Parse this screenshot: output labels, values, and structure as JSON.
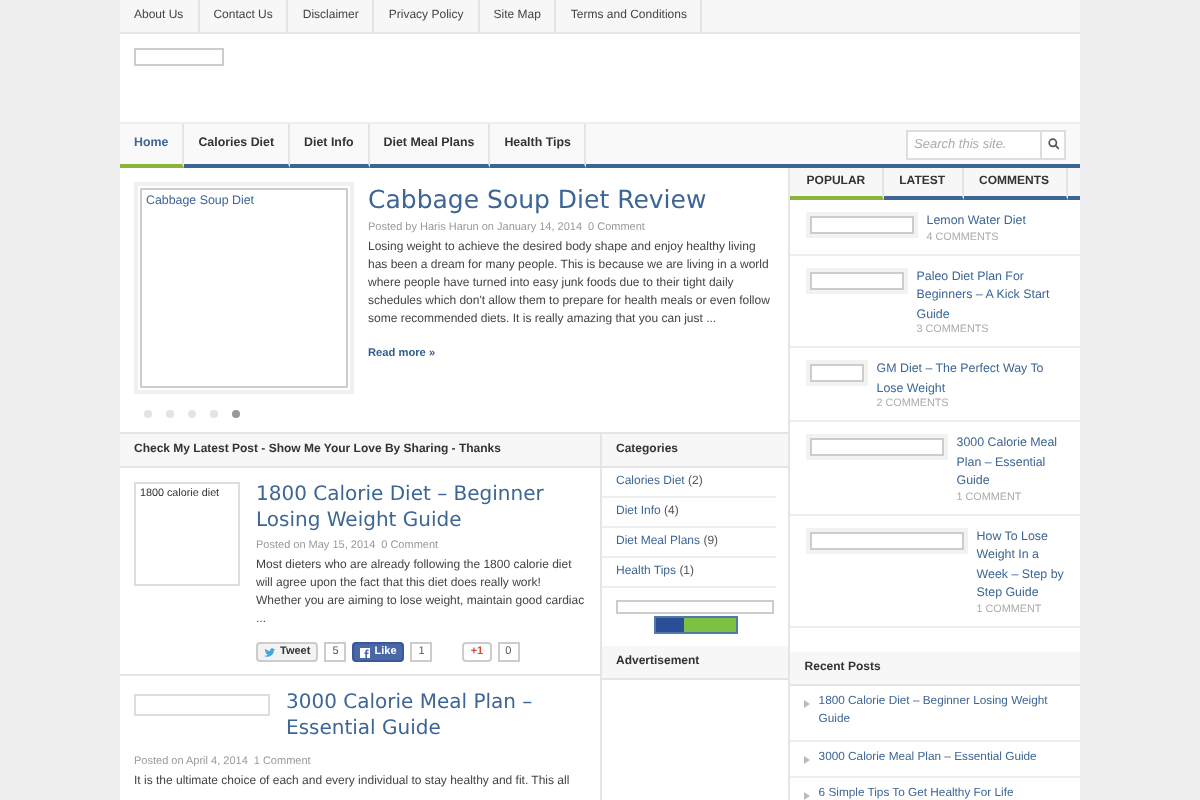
{
  "top_links": [
    "About Us",
    "Contact Us",
    "Disclaimer",
    "Privacy Policy",
    "Site Map",
    "Terms and Conditions"
  ],
  "nav": {
    "items": [
      {
        "label": "Home",
        "selected": true
      },
      {
        "label": "Calories Diet",
        "selected": false
      },
      {
        "label": "Diet Info",
        "selected": false
      },
      {
        "label": "Diet Meal Plans",
        "selected": false
      },
      {
        "label": "Health Tips",
        "selected": false
      }
    ],
    "search_placeholder": "Search this site."
  },
  "slider": {
    "image_alt": "Cabbage Soup Diet",
    "title": "Cabbage Soup Diet Review",
    "meta": "Posted by Haris Harun on January 14, 2014",
    "comments": "0 Comment",
    "excerpt": "Losing weight to achieve the desired body shape and enjoy healthy living has been a dream for many people. This is because we are living in a world where people have turned into easy junk foods due to their tight daily schedules which don't allow them to prepare for health meals or even follow some recommended diets. It is really amazing that you can just ...",
    "read_more": "Read more »",
    "dots": [
      {
        "selected": false
      },
      {
        "selected": false
      },
      {
        "selected": false
      },
      {
        "selected": false
      },
      {
        "selected": true
      }
    ]
  },
  "latest": {
    "heading": "Check My Latest Post - Show Me Your Love By Sharing - Thanks",
    "posts": [
      {
        "image_alt": "1800 calorie diet",
        "title": "1800 Calorie Diet – Beginner Losing Weight Guide",
        "meta": "Posted on May 15, 2014",
        "comments": "0 Comment",
        "excerpt": "Most dieters who are already following the 1800 calorie diet will agree upon the fact that this diet does really work! Whether you are aiming to lose weight, maintain good cardiac ...",
        "share": [
          {
            "kind": "tweet",
            "label": "Tweet",
            "count": "5"
          },
          {
            "kind": "like",
            "label": "Like",
            "count": "1"
          },
          {
            "kind": "gplus",
            "label": "+1",
            "count": "0"
          }
        ]
      },
      {
        "title": "3000 Calorie Meal Plan – Essential Guide",
        "meta": "Posted on April 4, 2014",
        "comments": "1 Comment",
        "excerpt": "It is the ultimate choice of each and every individual to stay healthy and fit. This all"
      }
    ]
  },
  "categories": {
    "heading": "Categories",
    "items": [
      {
        "label": "Calories Diet",
        "count": "(2)"
      },
      {
        "label": "Diet Info",
        "count": "(4)"
      },
      {
        "label": "Diet Meal Plans",
        "count": "(9)"
      },
      {
        "label": "Health Tips",
        "count": "(1)"
      }
    ]
  },
  "advertisement": {
    "heading": "Advertisement"
  },
  "sidebar": {
    "tabs": [
      {
        "label": "POPULAR",
        "selected": true
      },
      {
        "label": "LATEST",
        "selected": false
      },
      {
        "label": "COMMENTS",
        "selected": false
      }
    ],
    "popular": [
      {
        "title": "Lemon Water Diet",
        "comments": "4 COMMENTS"
      },
      {
        "title": "Paleo Diet Plan For Beginners – A Kick Start Guide",
        "comments": "3 COMMENTS"
      },
      {
        "title": "GM Diet – The Perfect Way To Lose Weight",
        "comments": "2 COMMENTS"
      },
      {
        "title": "3000 Calorie Meal Plan – Essential Guide",
        "comments": "1 COMMENT"
      },
      {
        "title": "How To Lose Weight In a Week – Step by Step Guide",
        "comments": "1 COMMENT"
      }
    ],
    "recent_heading": "Recent Posts",
    "recent": [
      "1800 Calorie Diet – Beginner Losing Weight Guide",
      "3000 Calorie Meal Plan – Essential Guide",
      "6 Simple Tips To Get Healthy For Life"
    ]
  }
}
